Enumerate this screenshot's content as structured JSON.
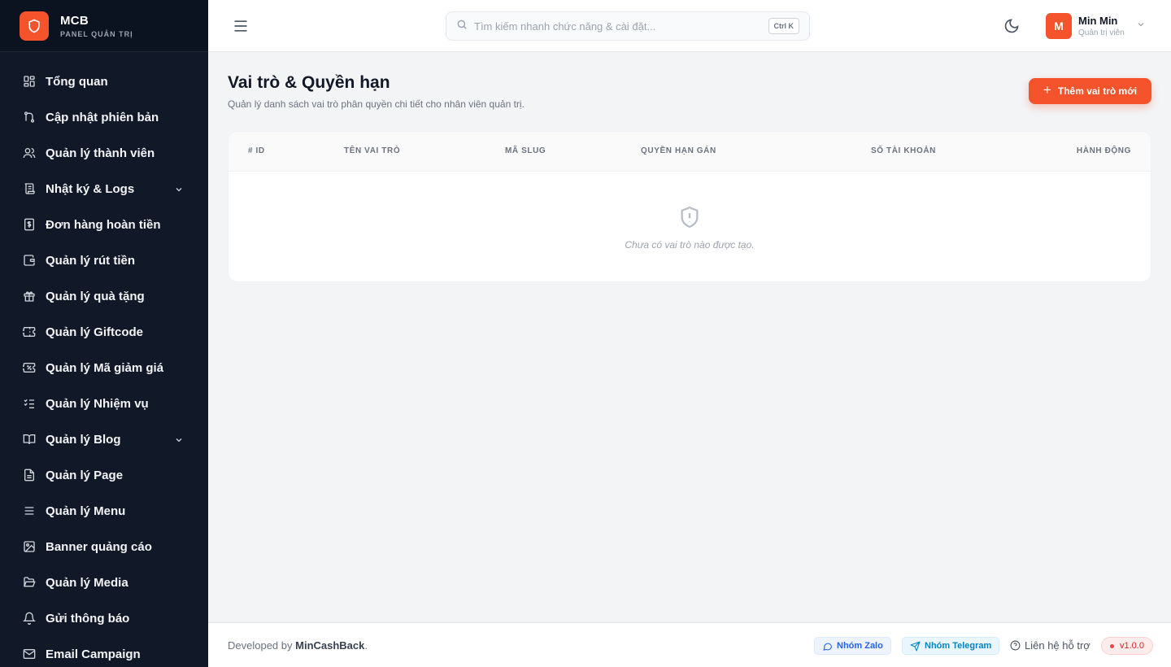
{
  "brand": {
    "name": "MCB",
    "subtitle": "PANEL QUẢN TRỊ"
  },
  "sidebar": {
    "items": [
      {
        "label": "Tổng quan",
        "icon": "dashboard-icon"
      },
      {
        "label": "Cập nhật phiên bản",
        "icon": "git-branch-icon"
      },
      {
        "label": "Quản lý thành viên",
        "icon": "users-icon"
      },
      {
        "label": "Nhật ký & Logs",
        "icon": "scroll-icon",
        "expandable": true
      },
      {
        "label": "Đơn hàng hoàn tiền",
        "icon": "receipt-dollar-icon"
      },
      {
        "label": "Quản lý rút tiền",
        "icon": "wallet-icon"
      },
      {
        "label": "Quản lý quà tặng",
        "icon": "gift-icon"
      },
      {
        "label": "Quản lý Giftcode",
        "icon": "ticket-icon"
      },
      {
        "label": "Quản lý Mã giảm giá",
        "icon": "coupon-icon"
      },
      {
        "label": "Quản lý Nhiệm vụ",
        "icon": "checklist-icon"
      },
      {
        "label": "Quản lý Blog",
        "icon": "book-open-icon",
        "expandable": true
      },
      {
        "label": "Quản lý Page",
        "icon": "file-text-icon"
      },
      {
        "label": "Quản lý Menu",
        "icon": "menu-lines-icon"
      },
      {
        "label": "Banner quảng cáo",
        "icon": "image-icon"
      },
      {
        "label": "Quản lý Media",
        "icon": "folder-open-icon"
      },
      {
        "label": "Gửi thông báo",
        "icon": "bell-icon"
      },
      {
        "label": "Email Campaign",
        "icon": "mail-icon"
      }
    ]
  },
  "header": {
    "search_placeholder": "Tìm kiếm nhanh chức năng & cài đặt...",
    "shortcut": "Ctrl K",
    "user": {
      "initial": "M",
      "name": "Min Min",
      "role": "Quản trị viên"
    }
  },
  "main": {
    "title": "Vai trò & Quyền hạn",
    "subtitle": "Quản lý danh sách vai trò phân quyền chi tiết cho nhân viên quản trị.",
    "add_button": "Thêm vai trò mới",
    "table": {
      "columns": [
        "# ID",
        "TÊN VAI TRÒ",
        "MÃ SLUG",
        "QUYỀN HẠN GÁN",
        "SỐ TÀI KHOẢN",
        "HÀNH ĐỘNG"
      ],
      "rows": [],
      "empty_text": "Chưa có vai trò nào được tạo."
    }
  },
  "footer": {
    "dev_prefix": "Developed by",
    "dev_name": "MinCashBack",
    "dev_suffix": ".",
    "zalo": "Nhóm Zalo",
    "telegram": "Nhóm Telegram",
    "support": "Liên hệ hỗ trợ",
    "version": "v1.0.0"
  },
  "colors": {
    "accent": "#f4532c",
    "sidebar_bg": "#111827"
  }
}
